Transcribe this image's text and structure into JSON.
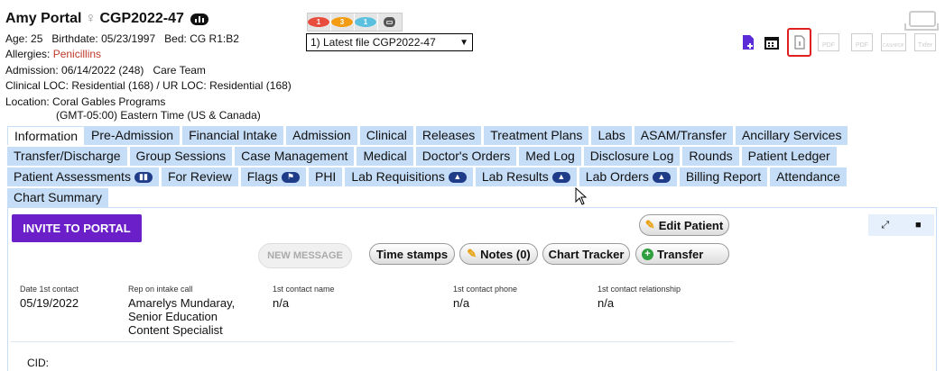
{
  "patient": {
    "name": "Amy Portal",
    "gender_symbol": "♀",
    "mrn": "CGP2022-47",
    "age": "Age: 25",
    "birthdate": "Birthdate: 05/23/1997",
    "bed": "Bed: CG R1:B2",
    "allergies_label": "Allergies:",
    "allergies_value": "Penicillins",
    "admission": "Admission: 06/14/2022 (248)",
    "care_team": "Care Team",
    "clinical_loc": "Clinical LOC: Residential (168) / UR LOC: Residential (168)",
    "location_label": "Location:",
    "location_value": "Coral Gables Programs",
    "timezone": "(GMT-05:00) Eastern Time (US & Canada)"
  },
  "counters": [
    {
      "value": "1",
      "color": "#e74c3c"
    },
    {
      "value": "3",
      "color": "#f39c12"
    },
    {
      "value": "1",
      "color": "#5bc0de"
    }
  ],
  "file_select": {
    "value": "1) Latest file CGP2022-47"
  },
  "top_icons": {
    "pdf1": "PDF",
    "pdf2": "PDF",
    "cashpdf": "CASHPDF",
    "txfer": "Txfer"
  },
  "tabs": {
    "row1": [
      "Information",
      "Pre-Admission",
      "Financial Intake",
      "Admission",
      "Clinical",
      "Releases",
      "Treatment Plans",
      "Labs",
      "ASAM/Transfer",
      "Ancillary Services"
    ],
    "row2": [
      "Transfer/Discharge",
      "Group Sessions",
      "Case Management",
      "Medical",
      "Doctor's Orders",
      "Med Log",
      "Disclosure Log",
      "Rounds",
      "Patient Ledger"
    ],
    "row3": [
      "Patient Assessments",
      "For Review",
      "Flags",
      "PHI",
      "Lab Requisitions",
      "Lab Results",
      "Lab Orders",
      "Billing Report",
      "Attendance"
    ],
    "row4": [
      "Chart Summary"
    ],
    "active": "Information"
  },
  "actions": {
    "invite": "INVITE TO PORTAL",
    "edit_patient": "Edit Patient",
    "new_message": "NEW MESSAGE",
    "time_stamps": "Time stamps",
    "notes": "Notes (0)",
    "chart_tracker": "Chart Tracker",
    "transfer": "Transfer"
  },
  "contact": {
    "date_label": "Date 1st contact",
    "date_value": "05/19/2022",
    "rep_label": "Rep on intake call",
    "rep_value": "Amarelys Mundaray, Senior Education Content Specialist",
    "name_label": "1st contact name",
    "name_value": "n/a",
    "phone_label": "1st contact phone",
    "phone_value": "n/a",
    "rel_label": "1st contact relationship",
    "rel_value": "n/a"
  },
  "cid_label": "CID:"
}
